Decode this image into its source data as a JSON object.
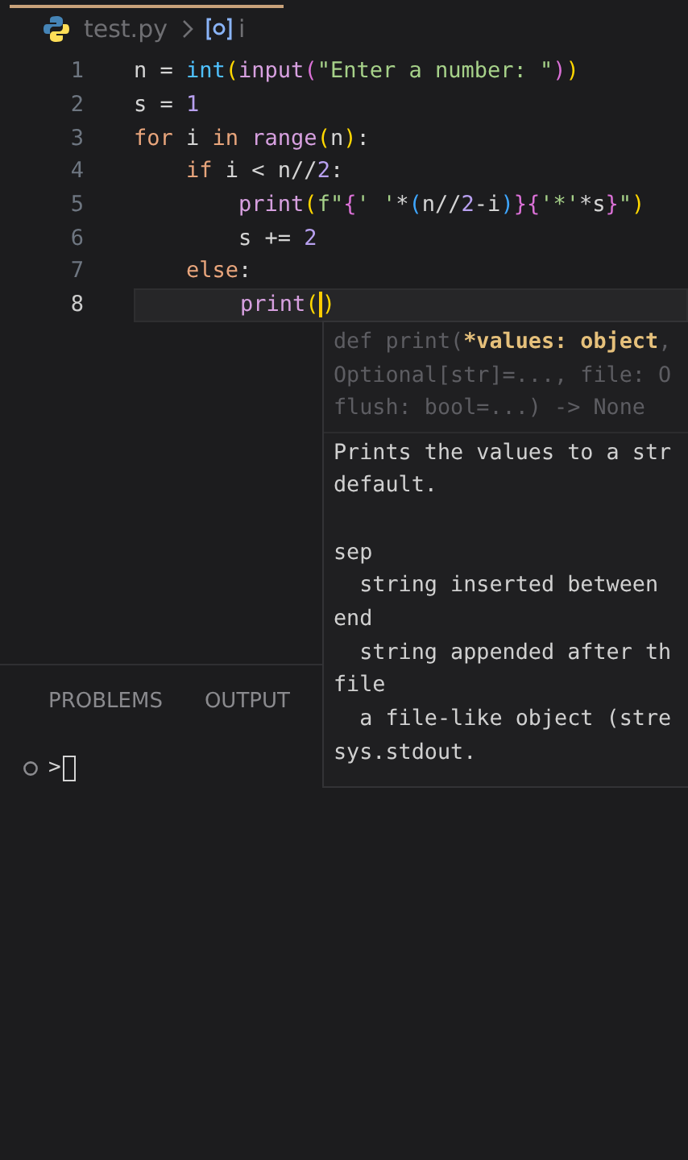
{
  "breadcrumb": {
    "file": "test.py",
    "symbol": "i"
  },
  "code_lines": [
    {
      "number": "1",
      "current": false,
      "tokens": [
        {
          "kind": "plain",
          "text": "n = "
        },
        {
          "kind": "builtin",
          "text": "int"
        },
        {
          "kind": "bracket1",
          "text": "("
        },
        {
          "kind": "func",
          "text": "input"
        },
        {
          "kind": "bracket2",
          "text": "("
        },
        {
          "kind": "string",
          "text": "\"Enter a number: \""
        },
        {
          "kind": "bracket2",
          "text": ")"
        },
        {
          "kind": "bracket1",
          "text": ")"
        }
      ]
    },
    {
      "number": "2",
      "current": false,
      "tokens": [
        {
          "kind": "plain",
          "text": "s = "
        },
        {
          "kind": "number",
          "text": "1"
        }
      ]
    },
    {
      "number": "3",
      "current": false,
      "tokens": [
        {
          "kind": "keyword",
          "text": "for"
        },
        {
          "kind": "plain",
          "text": " i "
        },
        {
          "kind": "keyword",
          "text": "in"
        },
        {
          "kind": "func",
          "text": " range"
        },
        {
          "kind": "bracket1",
          "text": "("
        },
        {
          "kind": "plain",
          "text": "n"
        },
        {
          "kind": "bracket1",
          "text": ")"
        },
        {
          "kind": "plain",
          "text": ":"
        }
      ]
    },
    {
      "number": "4",
      "current": false,
      "tokens": [
        {
          "kind": "keyword",
          "text": "    if"
        },
        {
          "kind": "plain",
          "text": " i < n//"
        },
        {
          "kind": "number",
          "text": "2"
        },
        {
          "kind": "plain",
          "text": ":"
        }
      ]
    },
    {
      "number": "5",
      "current": false,
      "tokens": [
        {
          "kind": "func",
          "text": "        print"
        },
        {
          "kind": "bracket1",
          "text": "("
        },
        {
          "kind": "string",
          "text": "f\""
        },
        {
          "kind": "bracket2",
          "text": "{"
        },
        {
          "kind": "string",
          "text": "' '"
        },
        {
          "kind": "plain",
          "text": "*"
        },
        {
          "kind": "bracket3",
          "text": "("
        },
        {
          "kind": "plain",
          "text": "n//"
        },
        {
          "kind": "number",
          "text": "2"
        },
        {
          "kind": "plain",
          "text": "-i"
        },
        {
          "kind": "bracket3",
          "text": ")"
        },
        {
          "kind": "bracket2",
          "text": "}{"
        },
        {
          "kind": "string",
          "text": "'*'"
        },
        {
          "kind": "plain",
          "text": "*s"
        },
        {
          "kind": "bracket2",
          "text": "}"
        },
        {
          "kind": "string",
          "text": "\""
        },
        {
          "kind": "bracket1",
          "text": ")"
        }
      ]
    },
    {
      "number": "6",
      "current": false,
      "tokens": [
        {
          "kind": "plain",
          "text": "        s += "
        },
        {
          "kind": "number",
          "text": "2"
        }
      ]
    },
    {
      "number": "7",
      "current": false,
      "tokens": [
        {
          "kind": "keyword",
          "text": "    else"
        },
        {
          "kind": "plain",
          "text": ":"
        }
      ]
    },
    {
      "number": "8",
      "current": true,
      "tokens": [
        {
          "kind": "func",
          "text": "        print"
        },
        {
          "kind": "bracket1",
          "text": "("
        },
        {
          "kind": "cursor"
        },
        {
          "kind": "bracket1",
          "text": ")"
        }
      ]
    }
  ],
  "hover": {
    "signature": [
      [
        {
          "kind": "dim",
          "text": "def print("
        },
        {
          "kind": "param",
          "text": "*values: object"
        },
        {
          "kind": "dim",
          "text": ","
        }
      ],
      [
        {
          "kind": "dim",
          "text": "Optional[str]=..., file: O"
        }
      ],
      [
        {
          "kind": "dim",
          "text": "flush: bool=...) -> None"
        }
      ]
    ],
    "doc": [
      [
        "Prints the values to a str",
        "default."
      ],
      [
        "sep",
        "  string inserted between",
        "end",
        "  string appended after th",
        "file",
        "  a file-like object (stre",
        "sys.stdout."
      ]
    ]
  },
  "panel": {
    "tabs": [
      "PROBLEMS",
      "OUTPUT"
    ],
    "prompt": ">"
  }
}
